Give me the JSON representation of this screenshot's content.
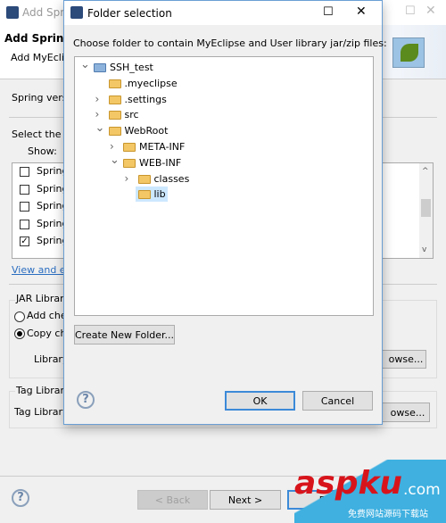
{
  "background_window": {
    "title": "Add Spring",
    "header_title": "Add Spring",
    "header_subtitle": "Add MyEcli",
    "spring_version_label": "Spring vers",
    "select_label": "Select the li",
    "show_label": "Show:",
    "list_items": [
      {
        "label": "Spring",
        "checked": false
      },
      {
        "label": "Spring",
        "checked": false
      },
      {
        "label": "Spring",
        "checked": false
      },
      {
        "label": "Spring",
        "checked": false
      },
      {
        "label": "Spring",
        "checked": true
      }
    ],
    "view_link": "View and e",
    "jar_group": "JAR Library",
    "radio_add": "Add che",
    "radio_copy": "Copy ch",
    "library_label": "Library",
    "browse1": "owse...",
    "tag_group": "Tag Librar",
    "tag_label": "Tag Library",
    "browse2": "owse...",
    "back": "< Back",
    "next": "Next >",
    "finish": "Fi"
  },
  "dialog": {
    "title": "Folder selection",
    "instruction": "Choose folder to contain MyEclipse and User library jar/zip files:",
    "tree": [
      {
        "label": "SSH_test",
        "level": 0,
        "expanded": true
      },
      {
        "label": ".myeclipse",
        "level": 1
      },
      {
        "label": ".settings",
        "level": 1,
        "expandable": true
      },
      {
        "label": "src",
        "level": 1,
        "expandable": true
      },
      {
        "label": "WebRoot",
        "level": 1,
        "expanded": true
      },
      {
        "label": "META-INF",
        "level": 2,
        "expandable": true
      },
      {
        "label": "WEB-INF",
        "level": 2,
        "expanded": true
      },
      {
        "label": "classes",
        "level": 3,
        "expandable": true
      },
      {
        "label": "lib",
        "level": 3,
        "selected": true
      }
    ],
    "create_folder": "Create New Folder...",
    "ok": "OK",
    "cancel": "Cancel"
  },
  "watermark": {
    "brand": "aspku",
    "suffix": ".com",
    "sub": "免费网站源码下载站"
  }
}
